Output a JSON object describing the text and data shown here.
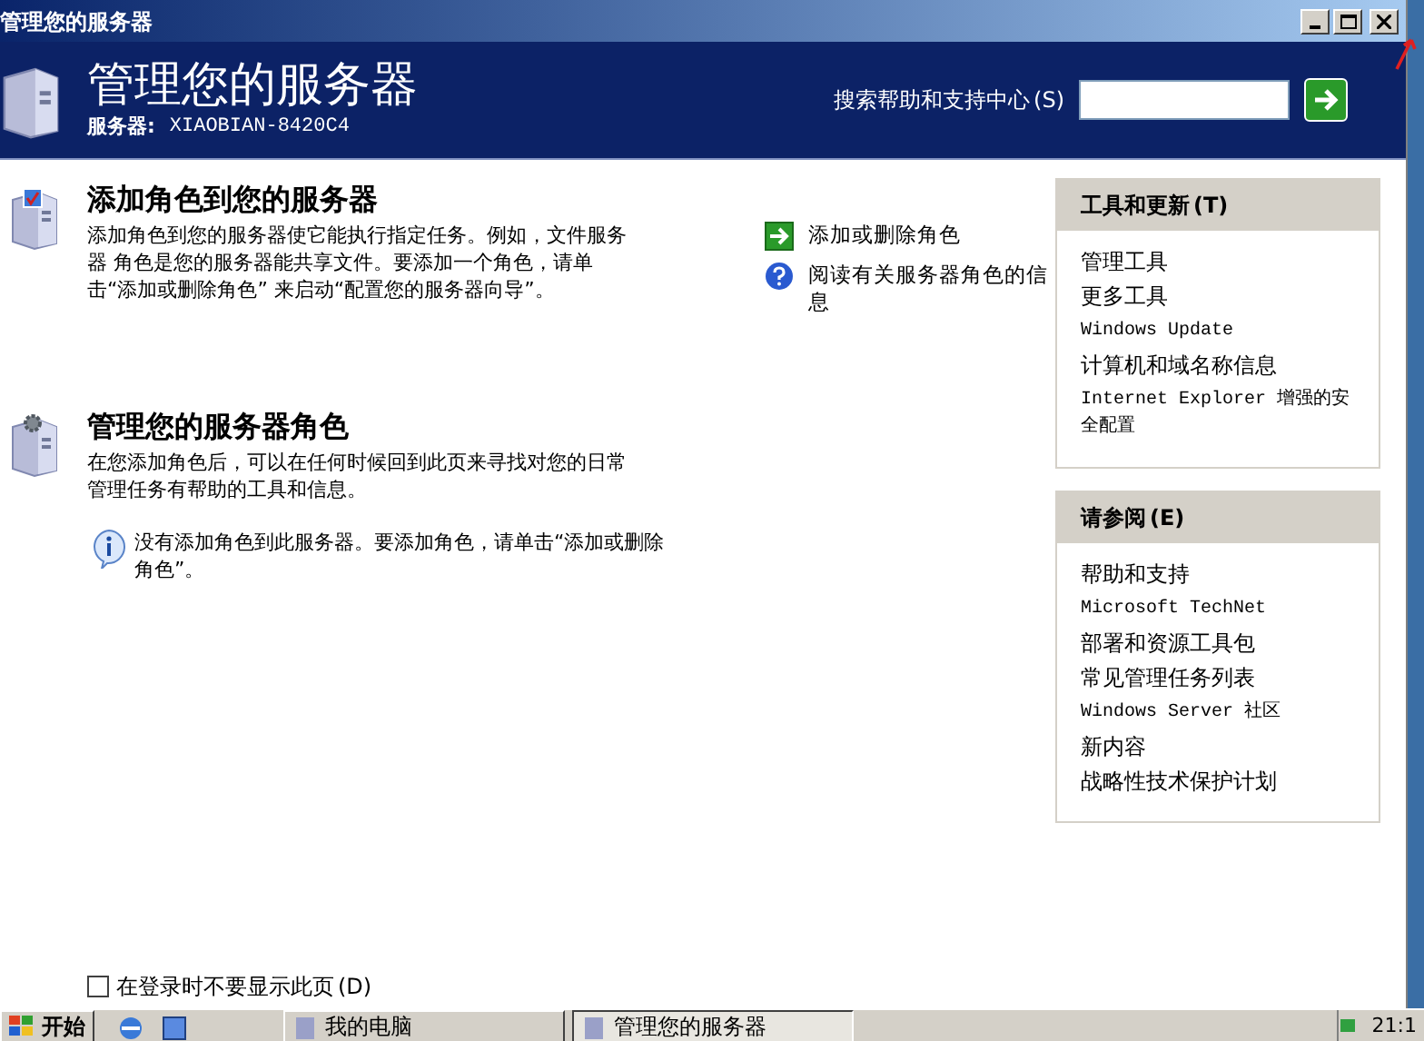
{
  "window": {
    "title": "管理您的服务器"
  },
  "header": {
    "title": "管理您的服务器",
    "server_label": "服务器:",
    "server_name": "XIAOBIAN-8420C4",
    "search_label": "搜索帮助和支持中心",
    "search_key": "(S)"
  },
  "sections": [
    {
      "kind": "add",
      "heading": "添加角色到您的服务器",
      "description": "添加角色到您的服务器使它能执行指定任务。例如，文件服务器 角色是您的服务器能共享文件。要添加一个角色，请单击“添加或删除角色” 来启动“配置您的服务器向导”。",
      "links": [
        {
          "kind": "go",
          "text": "添加或删除角色"
        },
        {
          "kind": "help",
          "text": "阅读有关服务器角色的信息"
        }
      ]
    },
    {
      "kind": "manage",
      "heading": "管理您的服务器角色",
      "description": "在您添加角色后，可以在任何时候回到此页来寻找对您的日常管理任务有帮助的工具和信息。",
      "note": "没有添加角色到此服务器。要添加角色，请单击“添加或删除角色”。"
    }
  ],
  "panels": [
    {
      "title": "工具和更新",
      "key": "(T)",
      "items": [
        {
          "text": "管理工具",
          "kind": "cjk"
        },
        {
          "text": "更多工具",
          "kind": "cjk"
        },
        {
          "text": "Windows Update",
          "kind": "latin"
        },
        {
          "text": "计算机和域名称信息",
          "kind": "cjk"
        },
        {
          "text": "Internet Explorer 增强的安全配置",
          "kind": "latin"
        }
      ]
    },
    {
      "title": "请参阅",
      "key": "(E)",
      "items": [
        {
          "text": "帮助和支持",
          "kind": "cjk"
        },
        {
          "text": "Microsoft TechNet",
          "kind": "latin"
        },
        {
          "text": "部署和资源工具包",
          "kind": "cjk"
        },
        {
          "text": "常见管理任务列表",
          "kind": "cjk"
        },
        {
          "text": "Windows Server 社区",
          "kind": "latin"
        },
        {
          "text": "新内容",
          "kind": "cjk"
        },
        {
          "text": "战略性技术保护计划",
          "kind": "cjk"
        }
      ]
    }
  ],
  "startup_checkbox": {
    "label": "在登录时不要显示此页",
    "key": "(D)",
    "checked": false
  },
  "taskbar": {
    "start": "开始",
    "tasks": [
      {
        "label": "我的电脑",
        "selected": false
      },
      {
        "label": "管理您的服务器",
        "selected": true
      }
    ],
    "clock": "21:1"
  }
}
